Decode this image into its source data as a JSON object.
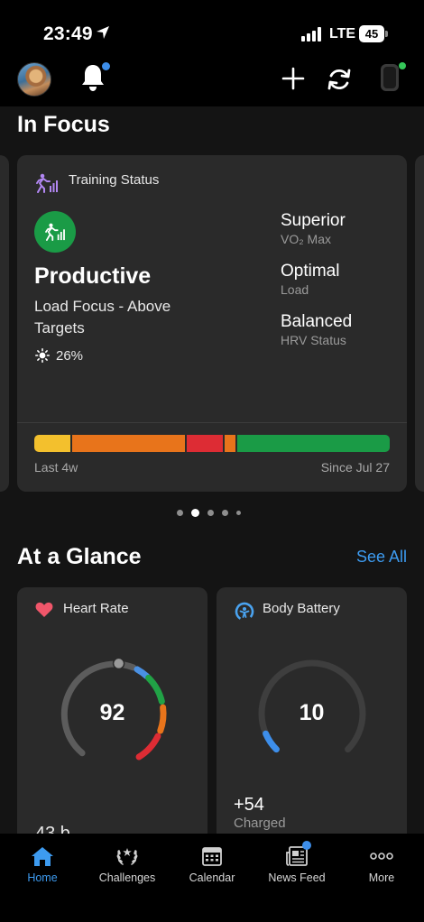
{
  "status_bar": {
    "time": "23:49",
    "carrier": "LTE",
    "battery": "45"
  },
  "header": {
    "icons": [
      "avatar",
      "bell-icon",
      "plus-icon",
      "sync-icon",
      "watch-icon"
    ],
    "notification_dot_color": "#3d8eea",
    "device_dot_color": "#35c759"
  },
  "in_focus": {
    "title": "In Focus",
    "training_status": {
      "label": "Training Status",
      "status": "Productive",
      "description": "Load Focus - Above Targets",
      "percent": "26%",
      "metrics": [
        {
          "value": "Superior",
          "label": "VO₂ Max"
        },
        {
          "value": "Optimal",
          "label": "Load"
        },
        {
          "value": "Balanced",
          "label": "HRV Status"
        }
      ],
      "bar_segments": [
        {
          "color": "#f3c02d",
          "weight": 40
        },
        {
          "color": "#e8741b",
          "weight": 125
        },
        {
          "color": "#dd2c34",
          "weight": 40
        },
        {
          "color": "#e8741b",
          "weight": 12
        },
        {
          "color": "#1a9b46",
          "weight": 169
        }
      ],
      "range_start": "Last 4w",
      "range_end": "Since Jul 27"
    },
    "pager": {
      "count": 5,
      "active_index": 1
    }
  },
  "at_a_glance": {
    "title": "At a Glance",
    "see_all": "See All",
    "heart_rate": {
      "label": "Heart Rate",
      "value": "92",
      "bottom_text": "43 b"
    },
    "body_battery": {
      "label": "Body Battery",
      "value": "10",
      "charge": "+54",
      "charge_label": "Charged",
      "level": 0.1
    }
  },
  "tabbar": {
    "items": [
      {
        "label": "Home",
        "icon": "home-icon",
        "active": true
      },
      {
        "label": "Challenges",
        "icon": "laurel-icon",
        "active": false
      },
      {
        "label": "Calendar",
        "icon": "calendar-icon",
        "active": false
      },
      {
        "label": "News Feed",
        "icon": "newsfeed-icon",
        "active": false
      },
      {
        "label": "More",
        "icon": "more-icon",
        "active": false
      }
    ],
    "active_color": "#3d9bf0"
  }
}
